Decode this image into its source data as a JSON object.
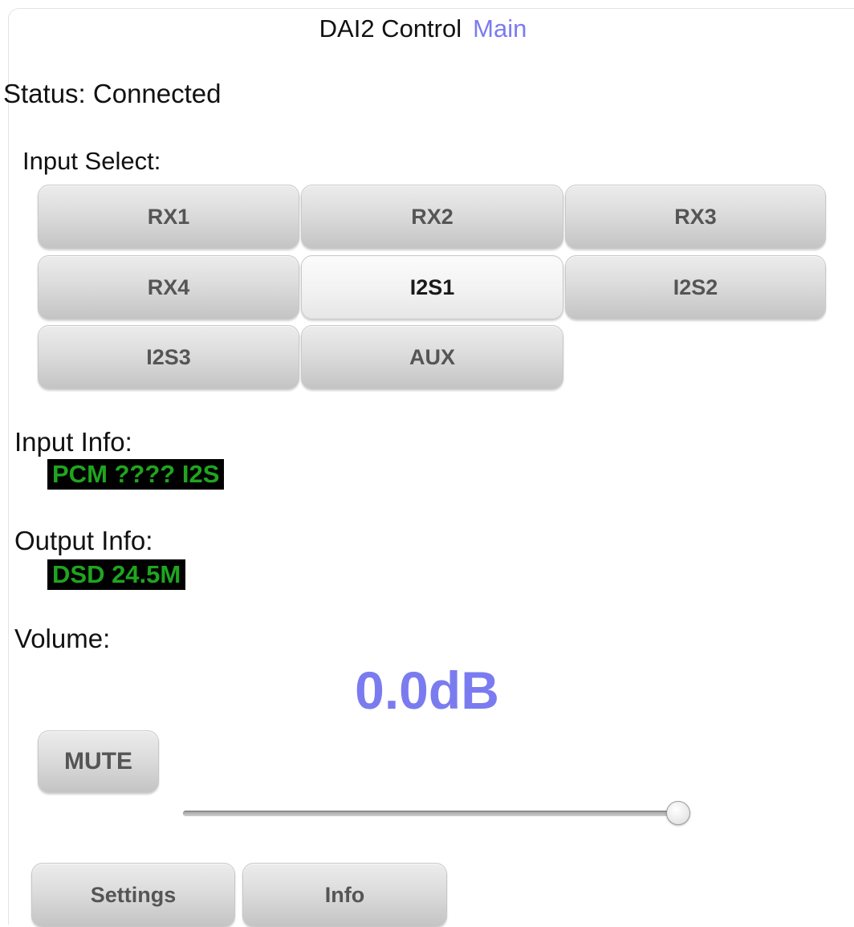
{
  "header": {
    "title": "DAI2 Control",
    "nav_link": "Main"
  },
  "status": {
    "text": "Status: Connected"
  },
  "input_select": {
    "label": "Input Select:",
    "options": [
      "RX1",
      "RX2",
      "RX3",
      "RX4",
      "I2S1",
      "I2S2",
      "I2S3",
      "AUX"
    ],
    "selected": "I2S1"
  },
  "input_info": {
    "label": "Input Info:",
    "value": "PCM ???? I2S"
  },
  "output_info": {
    "label": "Output Info:",
    "value": "DSD 24.5M"
  },
  "volume": {
    "label": "Volume:",
    "value": "0.0dB",
    "slider_fraction": 1.0,
    "mute_label": "MUTE"
  },
  "footer": {
    "settings_label": "Settings",
    "info_label": "Info"
  },
  "colors": {
    "accent": "#7b7bf0",
    "lcd_background": "#000000",
    "lcd_text": "#1fa51f"
  }
}
